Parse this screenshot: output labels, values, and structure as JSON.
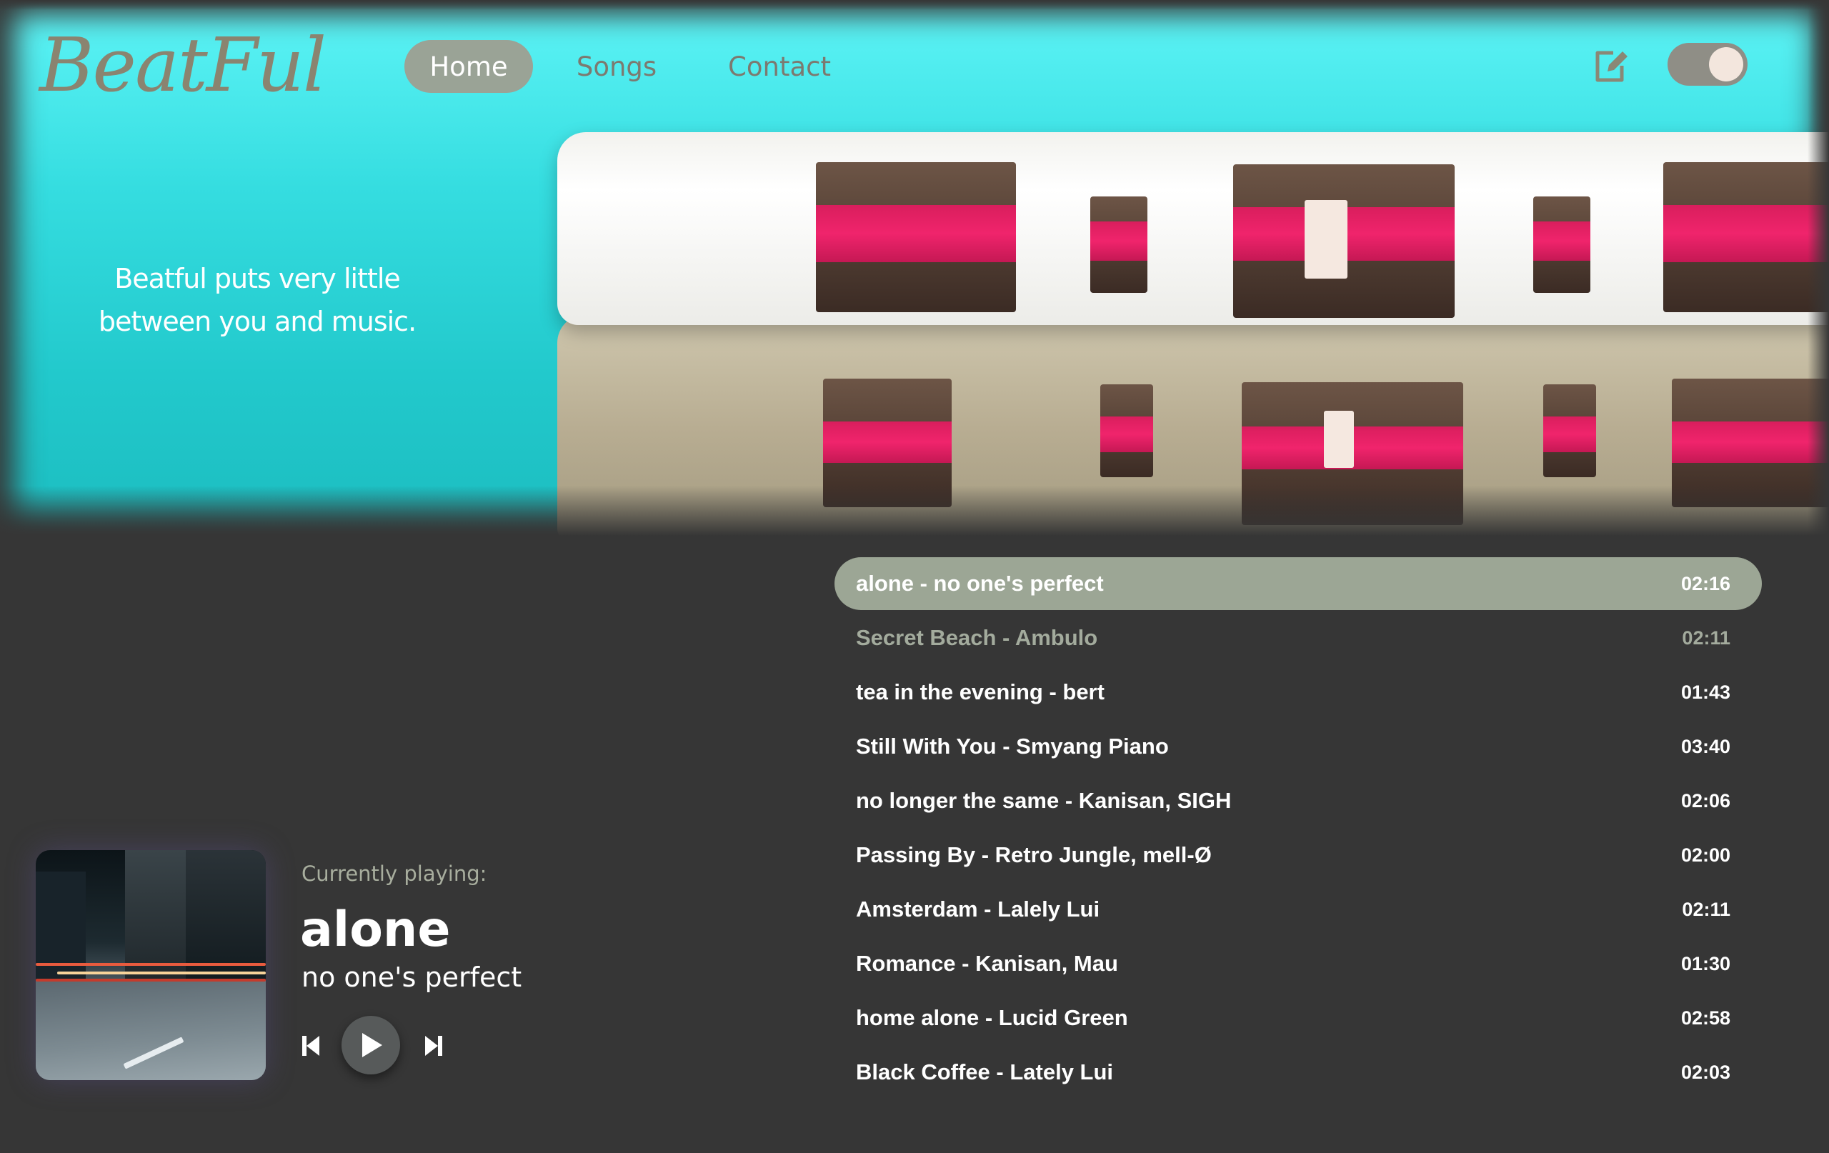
{
  "brand": {
    "logo": "BeatFul"
  },
  "nav": {
    "items": [
      {
        "label": "Home",
        "active": true
      },
      {
        "label": "Songs",
        "active": false
      },
      {
        "label": "Contact",
        "active": false
      }
    ],
    "edit_icon": "edit-icon",
    "theme_toggle": {
      "on": true
    }
  },
  "hero": {
    "tagline_line1": "Beatful puts very little",
    "tagline_line2": "between you and music."
  },
  "tracks": [
    {
      "title": "alone - no one's perfect",
      "duration": "02:16",
      "state": "playing"
    },
    {
      "title": "Secret Beach - Ambulo",
      "duration": "02:11",
      "state": "hover"
    },
    {
      "title": "tea in the evening - bert",
      "duration": "01:43",
      "state": "normal"
    },
    {
      "title": "Still With You - Smyang Piano",
      "duration": "03:40",
      "state": "normal"
    },
    {
      "title": "no longer the same - Kanisan, SIGH",
      "duration": "02:06",
      "state": "normal"
    },
    {
      "title": "Passing By - Retro Jungle, mell-Ø",
      "duration": "02:00",
      "state": "normal"
    },
    {
      "title": "Amsterdam - Lalely Lui",
      "duration": "02:11",
      "state": "normal"
    },
    {
      "title": "Romance - Kanisan, Mau",
      "duration": "01:30",
      "state": "normal"
    },
    {
      "title": "home alone - Lucid Green",
      "duration": "02:58",
      "state": "normal"
    },
    {
      "title": "Black Coffee - Lately Lui",
      "duration": "02:03",
      "state": "normal"
    }
  ],
  "player": {
    "label": "Currently playing:",
    "title": "alone",
    "artist": "no one's perfect",
    "controls": [
      "previous-icon",
      "play-icon",
      "next-icon"
    ]
  },
  "colors": {
    "accent": "#9ca695",
    "background": "#363636",
    "hero": "#35dde0",
    "tape": "#f0246c"
  }
}
